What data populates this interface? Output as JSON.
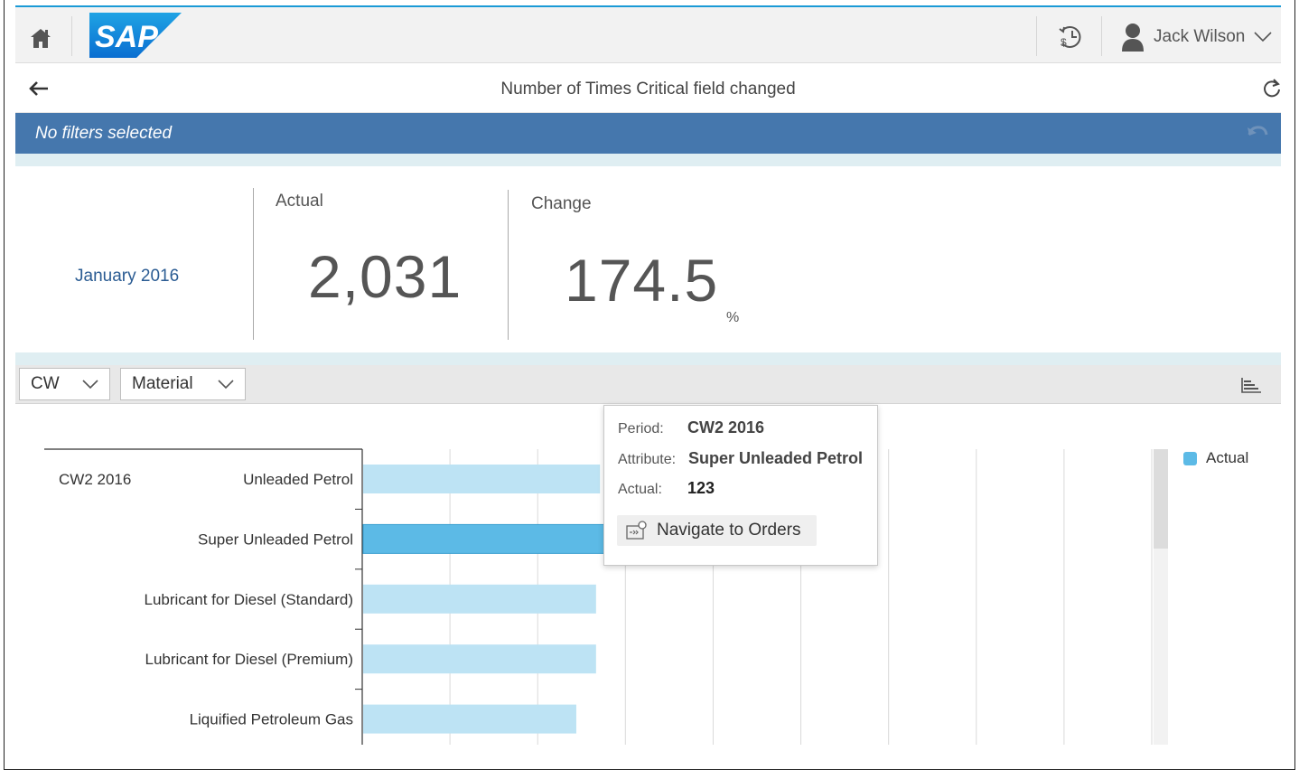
{
  "shell": {
    "user_name": "Jack Wilson",
    "logo_text": "SAP",
    "brand_colors": {
      "accent": "#1a9ad6",
      "logo_blue": "#0a6ed1"
    }
  },
  "page": {
    "title": "Number of Times Critical field changed"
  },
  "filter": {
    "text": "No filters selected",
    "bar_color": "#4577ad"
  },
  "kpi": {
    "period": "January 2016",
    "actual_label": "Actual",
    "actual_value": "2,031",
    "change_label": "Change",
    "change_value": "174.5",
    "change_unit": "%"
  },
  "toolbar": {
    "dimension1": "CW",
    "dimension2": "Material"
  },
  "chart_data": {
    "type": "bar",
    "orientation": "horizontal",
    "group_label": "CW2 2016",
    "categories": [
      "Unleaded Petrol",
      "Super Unleaded Petrol",
      "Lubricant for Diesel (Standard)",
      "Lubricant for Diesel (Premium)",
      "Liquified Petroleum Gas"
    ],
    "series": [
      {
        "name": "Actual",
        "values": [
          60,
          123,
          59,
          59,
          54
        ],
        "color": "#5cbae6",
        "light_color": "#bde3f4"
      }
    ],
    "highlighted_index": 1,
    "xlim": [
      0,
      200
    ],
    "gridlines": 10,
    "legend_position": "top-right"
  },
  "popover": {
    "period_key": "Period:",
    "period_val": "CW2 2016",
    "attribute_key": "Attribute:",
    "attribute_val": "Super Unleaded Petrol",
    "actual_key": "Actual:",
    "actual_val": "123",
    "nav_label": "Navigate to Orders"
  }
}
